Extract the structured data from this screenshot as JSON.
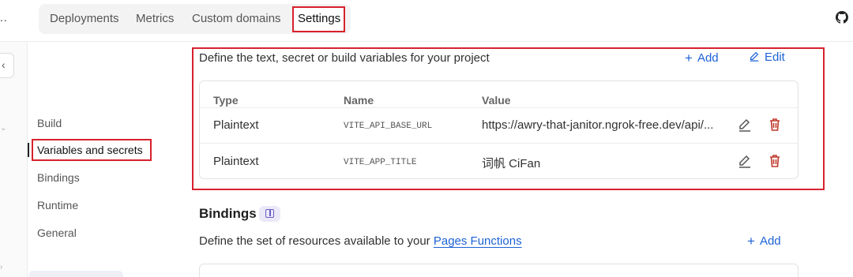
{
  "topbar": {
    "app_dots": "..",
    "tabs": [
      {
        "label": "Deployments"
      },
      {
        "label": "Metrics"
      },
      {
        "label": "Custom domains"
      },
      {
        "label": "Settings"
      }
    ],
    "github_icon": "github-icon"
  },
  "settings_nav": {
    "items": [
      {
        "label": "Build"
      },
      {
        "label": "Variables and secrets"
      },
      {
        "label": "Bindings"
      },
      {
        "label": "Runtime"
      },
      {
        "label": "General"
      }
    ],
    "active": "Variables and secrets"
  },
  "variables": {
    "description": "Define the text, secret or build variables for your project",
    "add_label": "Add",
    "edit_label": "Edit",
    "columns": [
      "Type",
      "Name",
      "Value"
    ],
    "rows": [
      {
        "type": "Plaintext",
        "name": "VITE_API_BASE_URL",
        "value": "https://awry-that-janitor.ngrok-free.dev/api/..."
      },
      {
        "type": "Plaintext",
        "name": "VITE_APP_TITLE",
        "value": "词帆 CiFan"
      }
    ]
  },
  "bindings": {
    "title": "Bindings",
    "description_prefix": "Define the set of resources available to your ",
    "description_link": "Pages Functions",
    "add_label": "Add"
  },
  "colors": {
    "accent": "#1d62d6",
    "highlight": "#d7212d",
    "delete": "#c0392b"
  }
}
